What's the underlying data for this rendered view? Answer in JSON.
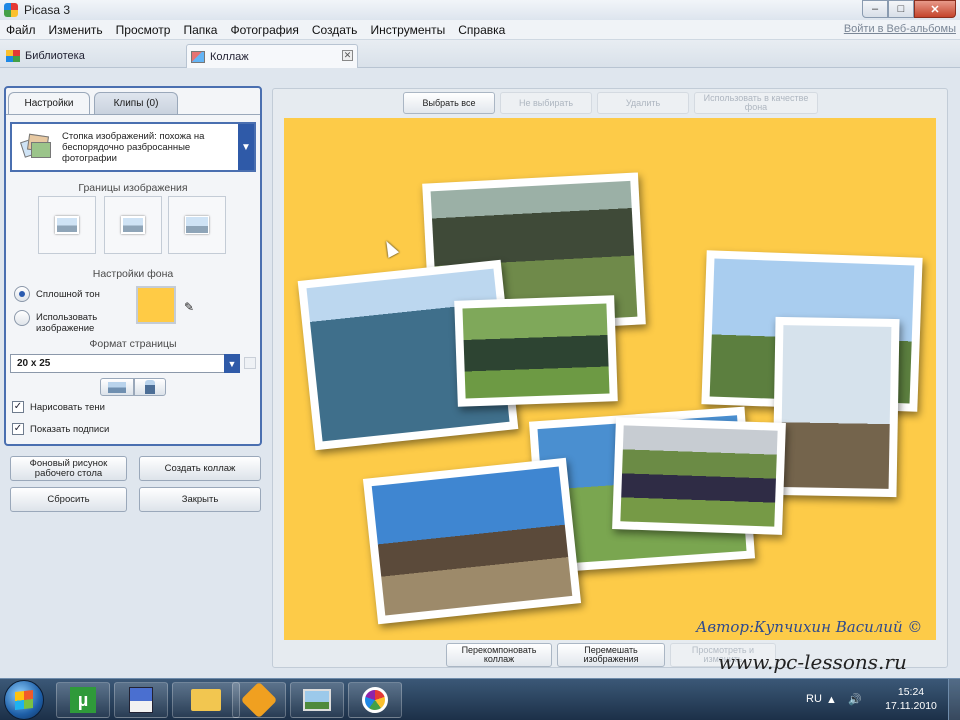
{
  "window": {
    "title": "Picasa 3",
    "minimize": "–",
    "maximize": "□",
    "close": "✕"
  },
  "menu": {
    "items": [
      "Файл",
      "Изменить",
      "Просмотр",
      "Папка",
      "Фотография",
      "Создать",
      "Инструменты",
      "Справка"
    ],
    "web_albums_link": "Войти в Веб-альбомы"
  },
  "tabs": {
    "library": "Библиотека",
    "collage": "Коллаж",
    "close": "✕"
  },
  "left_panel": {
    "tab_settings": "Настройки",
    "tab_clips": "Клипы (0)",
    "style_text": "Стопка изображений: похожа на беспорядочно разбросанные фотографии",
    "image_borders_label": "Границы изображения",
    "background_label": "Настройки фона",
    "solid_color_label": "Сплошной тон",
    "use_image_label": "Использовать изображение",
    "background_color": "#ffcb45",
    "page_format_label": "Формат страницы",
    "page_format_value": "20 x 25",
    "draw_shadows_label": "Нарисовать тени",
    "show_captions_label": "Показать подписи",
    "draw_shadows_checked": true,
    "show_captions_checked": true,
    "buttons": {
      "desktop_bg": "Фоновый рисунок рабочего стола",
      "create_collage": "Создать коллаж",
      "reset": "Сбросить",
      "close": "Закрыть"
    }
  },
  "collage": {
    "top_buttons": {
      "select_all": "Выбрать все",
      "select_none": "Не выбирать",
      "delete": "Удалить",
      "use_as_bg": "Использовать в качестве фона"
    },
    "canvas_color": "#fdcb48",
    "author": "Автор:Купчихин Василий ©",
    "bottom_buttons": {
      "rearrange": "Перекомпоновать коллаж",
      "shuffle": "Перемешать изображения",
      "view_images": "Просмотреть и изменить"
    },
    "watermark": "www.pc-lessons.ru"
  },
  "taskbar": {
    "utorrent_label": "µ",
    "language": "RU",
    "tray_icons": "▲ 🔊",
    "time": "15:24",
    "date": "17.11.2010"
  }
}
